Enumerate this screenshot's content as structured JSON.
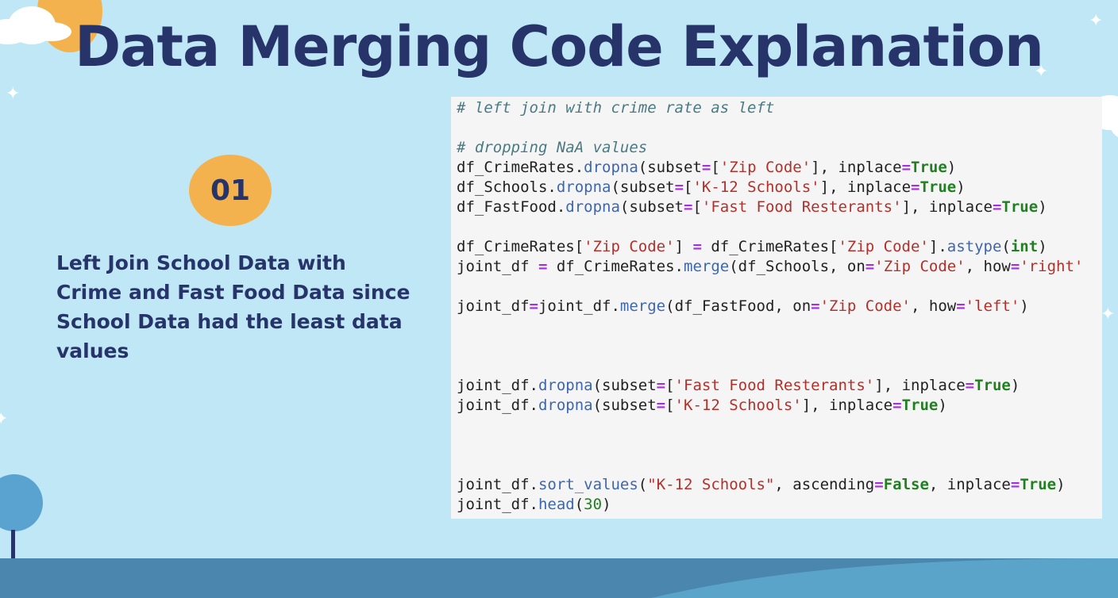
{
  "slide": {
    "title": "Data Merging Code Explanation",
    "badge": "01",
    "description": "Left Join School Data with Crime and Fast Food Data since School Data had the least data values"
  },
  "colors": {
    "background": "#bfe7f6",
    "title": "#27346a",
    "accent": "#f3b24d",
    "code_background": "#f5f5f5",
    "ground": "#4a86ad"
  },
  "code": {
    "lines": [
      "# left join with crime rate as left",
      "",
      "# dropping NaA values",
      "df_CrimeRates.dropna(subset=['Zip Code'], inplace=True)",
      "df_Schools.dropna(subset=['K-12 Schools'], inplace=True)",
      "df_FastFood.dropna(subset=['Fast Food Resterants'], inplace=True)",
      "",
      "df_CrimeRates['Zip Code'] = df_CrimeRates['Zip Code'].astype(int)",
      "joint_df = df_CrimeRates.merge(df_Schools, on='Zip Code', how='right'",
      "",
      "joint_df=joint_df.merge(df_FastFood, on='Zip Code', how='left')",
      "",
      "",
      "",
      "joint_df.dropna(subset=['Fast Food Resterants'], inplace=True)",
      "joint_df.dropna(subset=['K-12 Schools'], inplace=True)",
      "",
      "",
      "",
      "joint_df.sort_values(\"K-12 Schools\", ascending=False, inplace=True)",
      "joint_df.head(30)"
    ]
  },
  "icons": [
    "sun-icon",
    "cloud-icon",
    "sparkle-icon",
    "tree-icon"
  ]
}
